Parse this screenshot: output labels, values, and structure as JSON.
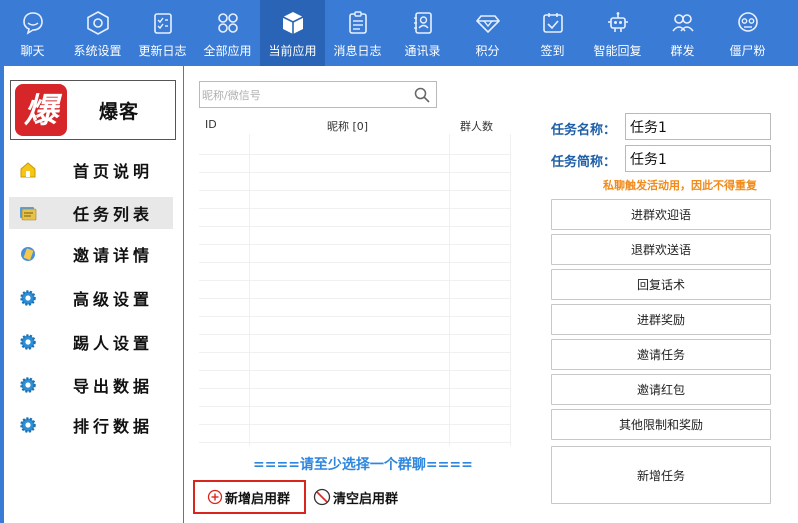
{
  "topbar": {
    "items": [
      {
        "label": "聊天",
        "icon": "chat-icon"
      },
      {
        "label": "系统设置",
        "icon": "hexagon-settings-icon"
      },
      {
        "label": "更新日志",
        "icon": "checklist-icon"
      },
      {
        "label": "全部应用",
        "icon": "apps-grid-icon"
      },
      {
        "label": "当前应用",
        "icon": "box-icon",
        "active": true
      },
      {
        "label": "消息日志",
        "icon": "message-log-icon"
      },
      {
        "label": "通讯录",
        "icon": "contacts-book-icon"
      },
      {
        "label": "积分",
        "icon": "diamond-icon"
      },
      {
        "label": "签到",
        "icon": "calendar-check-icon"
      },
      {
        "label": "智能回复",
        "icon": "robot-icon"
      },
      {
        "label": "群发",
        "icon": "group-users-icon"
      },
      {
        "label": "僵尸粉",
        "icon": "zombie-icon"
      }
    ],
    "bg_color": "#3a7bd5",
    "active_color": "#2a64b6"
  },
  "sidebar": {
    "app_name": "爆客",
    "logo_char": "爆",
    "items": [
      {
        "label": "首页说明",
        "icon": "home-icon"
      },
      {
        "label": "任务列表",
        "icon": "task-list-icon",
        "active": true
      },
      {
        "label": "邀请详情",
        "icon": "invite-icon"
      },
      {
        "label": "高级设置",
        "icon": "gear-icon"
      },
      {
        "label": "踢人设置",
        "icon": "gear-icon"
      },
      {
        "label": "导出数据",
        "icon": "gear-icon"
      },
      {
        "label": "排行数据",
        "icon": "gear-icon"
      }
    ]
  },
  "main": {
    "search": {
      "placeholder": "昵称/微信号",
      "value": ""
    },
    "table": {
      "headers": [
        "ID",
        "昵称 [0]",
        "",
        "群人数"
      ],
      "rows": []
    },
    "hint": "====请至少选择一个群聊====",
    "add_group_label": "新增启用群",
    "clear_group_label": "清空启用群"
  },
  "task": {
    "name_label": "任务名称：",
    "name_value": "任务1",
    "short_label": "任务简称：",
    "short_value": "任务1",
    "warning": "私聊触发活动用，因此不得重复",
    "buttons": [
      "进群欢迎语",
      "退群欢送语",
      "回复话术",
      "进群奖励",
      "邀请任务",
      "邀请红包",
      "其他限制和奖励",
      "新增任务"
    ]
  }
}
